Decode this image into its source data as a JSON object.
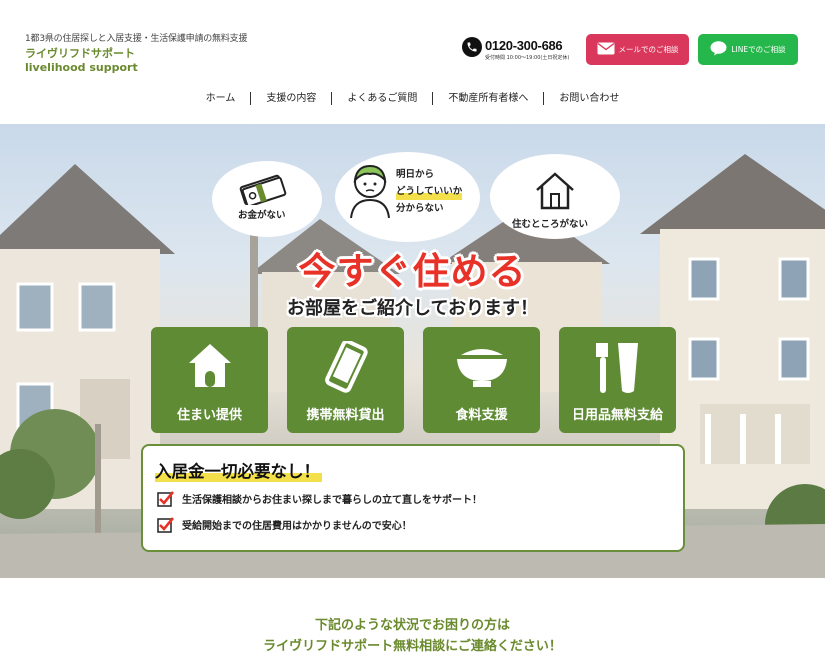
{
  "header": {
    "tagline": "1都3県の住居探しと入居支援・生活保護申請の無料支援",
    "brand_ja": "ライヴリフドサポート",
    "brand_en": "livelihood support",
    "phone": "0120-300-686",
    "phone_hours": "受付時間 10:00〜19:00(土日祝定休)",
    "mail_button": "メールでのご相談",
    "line_button": "LINEでのご相談",
    "colors": {
      "brand_green": "#6a8a2e",
      "mail_red": "#d9375b",
      "line_green": "#25b74b"
    }
  },
  "nav": {
    "items": [
      "ホーム",
      "支援の内容",
      "よくあるご質問",
      "不動産所有者様へ",
      "お問い合わせ"
    ]
  },
  "hero": {
    "bubbles": {
      "money": "お金がない",
      "tomorrow_1": "明日から",
      "tomorrow_2": "どうしていいか",
      "tomorrow_3": "分からない",
      "home": "住むところがない"
    },
    "headline": "今すぐ住める",
    "subheadline": "お部屋をご紹介しております！",
    "tiles": [
      {
        "label": "住まい提供",
        "icon": "house-icon"
      },
      {
        "label": "携帯無料貸出",
        "icon": "smartphone-icon"
      },
      {
        "label": "食料支援",
        "icon": "rice-bowl-icon"
      },
      {
        "label": "日用品無料支給",
        "icon": "toothbrush-icon"
      }
    ],
    "info": {
      "title": "入居金一切必要なし！",
      "points": [
        "生活保護相談からお住まい探しまで暮らしの立て直しをサポート！",
        "受給開始までの住居費用はかかりませんので安心！"
      ]
    },
    "colors": {
      "headline_red": "#e83228",
      "tile_green": "#5f8b35",
      "highlight_yellow": "#f3e04a"
    }
  },
  "bottom": {
    "line1": "下記のような状況でお困りの方は",
    "line2": "ライヴリフドサポート無料相談にご連絡ください！"
  }
}
